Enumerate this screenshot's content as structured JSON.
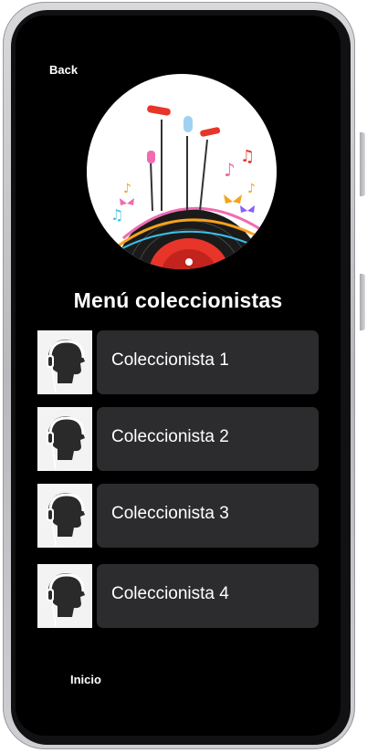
{
  "nav": {
    "back_label": "Back",
    "home_label": "Inicio"
  },
  "page": {
    "title": "Menú coleccionistas"
  },
  "collectors": [
    {
      "label": "Coleccionista 1"
    },
    {
      "label": "Coleccionista 2"
    },
    {
      "label": "Coleccionista 3"
    },
    {
      "label": "Coleccionista 4"
    }
  ],
  "colors": {
    "background": "#000000",
    "card": "#2c2c2e",
    "text": "#ffffff",
    "accent": "#e8352a"
  },
  "icons": {
    "hero": "music-vinyl-microphones-illustration",
    "thumbnail": "headphones-head-silhouette-icon"
  }
}
